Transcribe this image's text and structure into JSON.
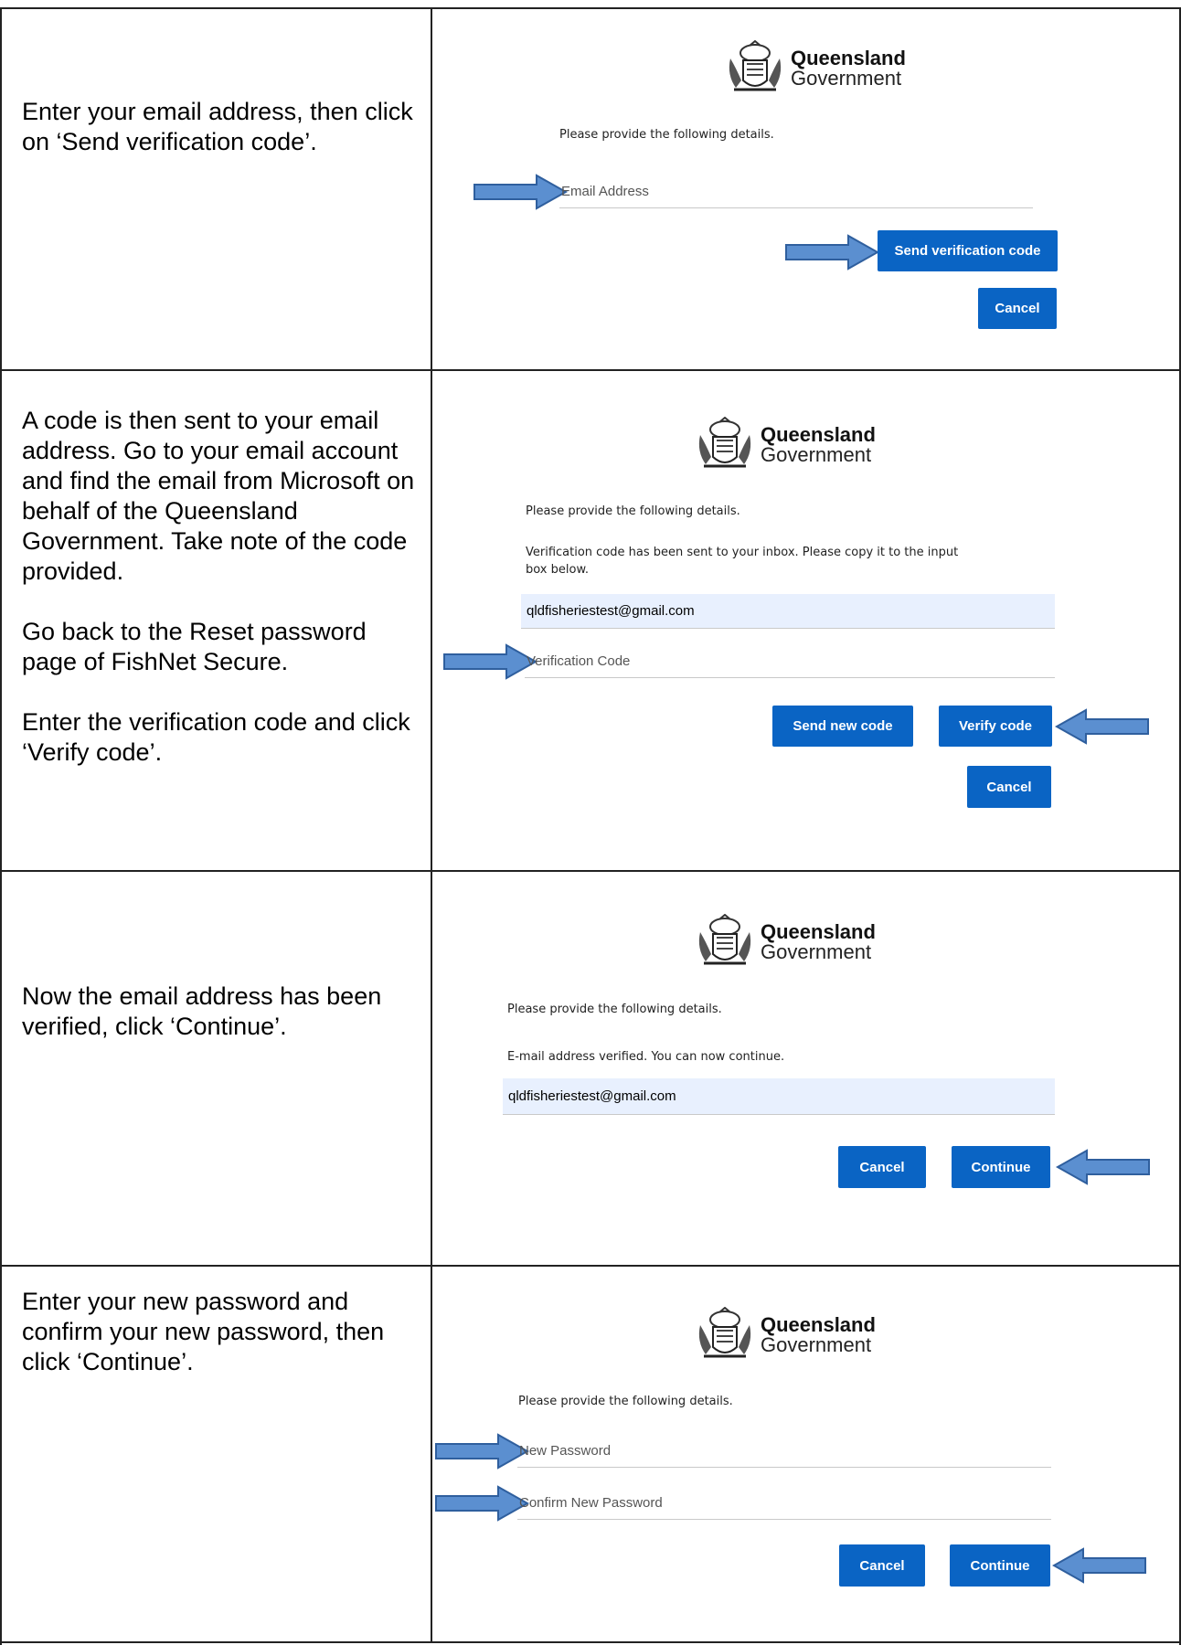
{
  "logo": {
    "line1": "Queensland",
    "line2": "Government"
  },
  "steps": [
    {
      "instructions": [
        "Enter your email address, then click on ‘Send verification code’."
      ],
      "intro": "Please provide the following details.",
      "email_placeholder": "Email Address",
      "send_button": "Send verification code",
      "cancel_button": "Cancel"
    },
    {
      "instructions": [
        "A code is then sent to your email address. Go to your email account and find the email from Microsoft on behalf of the Queensland Government. Take note of the code provided.",
        "Go back to the Reset password page of FishNet Secure.",
        "Enter the verification code and click ‘Verify code’."
      ],
      "intro": "Please provide the following details.",
      "notice_line1": "Verification code has been sent to your inbox. Please copy it to the input",
      "notice_line2": "box below.",
      "email_value": "qldfisheriestest@gmail.com",
      "code_placeholder": "Verification Code",
      "send_new_button": "Send new code",
      "verify_button": "Verify code",
      "cancel_button": "Cancel"
    },
    {
      "instructions": [
        "Now the email address has been verified, click ‘Continue’."
      ],
      "intro": "Please provide the following details.",
      "notice": "E-mail address verified. You can now continue.",
      "email_value": "qldfisheriestest@gmail.com",
      "cancel_button": "Cancel",
      "continue_button": "Continue"
    },
    {
      "instructions": [
        "Enter your new password and confirm your new password, then click ‘Continue’."
      ],
      "intro": "Please provide the following details.",
      "new_password_placeholder": "New Password",
      "confirm_password_placeholder": "Confirm New Password",
      "cancel_button": "Cancel",
      "continue_button": "Continue"
    }
  ],
  "colors": {
    "button": "#0a64c4",
    "arrow_fill": "#5b8fd0",
    "arrow_stroke": "#2f5f9e",
    "filled_field": "#e8f0fe"
  }
}
